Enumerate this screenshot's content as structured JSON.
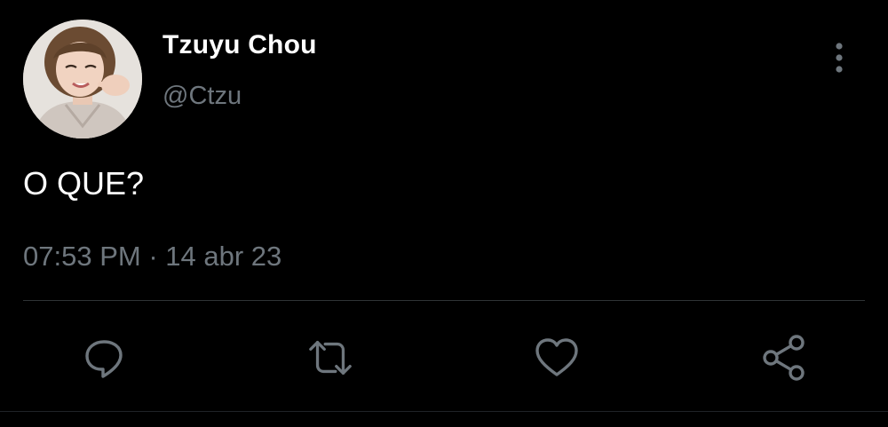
{
  "author": {
    "display_name": "Tzuyu Chou",
    "handle": "@Ctzu",
    "avatar_icon": "profile-photo"
  },
  "tweet": {
    "text": "O QUE?",
    "time": "07:53 PM",
    "separator": "·",
    "date": "14 abr 23"
  },
  "actions": [
    {
      "name": "reply",
      "icon": "reply-icon"
    },
    {
      "name": "retweet",
      "icon": "retweet-icon"
    },
    {
      "name": "like",
      "icon": "heart-icon"
    },
    {
      "name": "share",
      "icon": "share-icon"
    }
  ],
  "colors": {
    "background": "#000000",
    "primary_text": "#ffffff",
    "secondary_text": "#6e767d",
    "divider": "#2f3336",
    "icon": "#6e767d"
  }
}
